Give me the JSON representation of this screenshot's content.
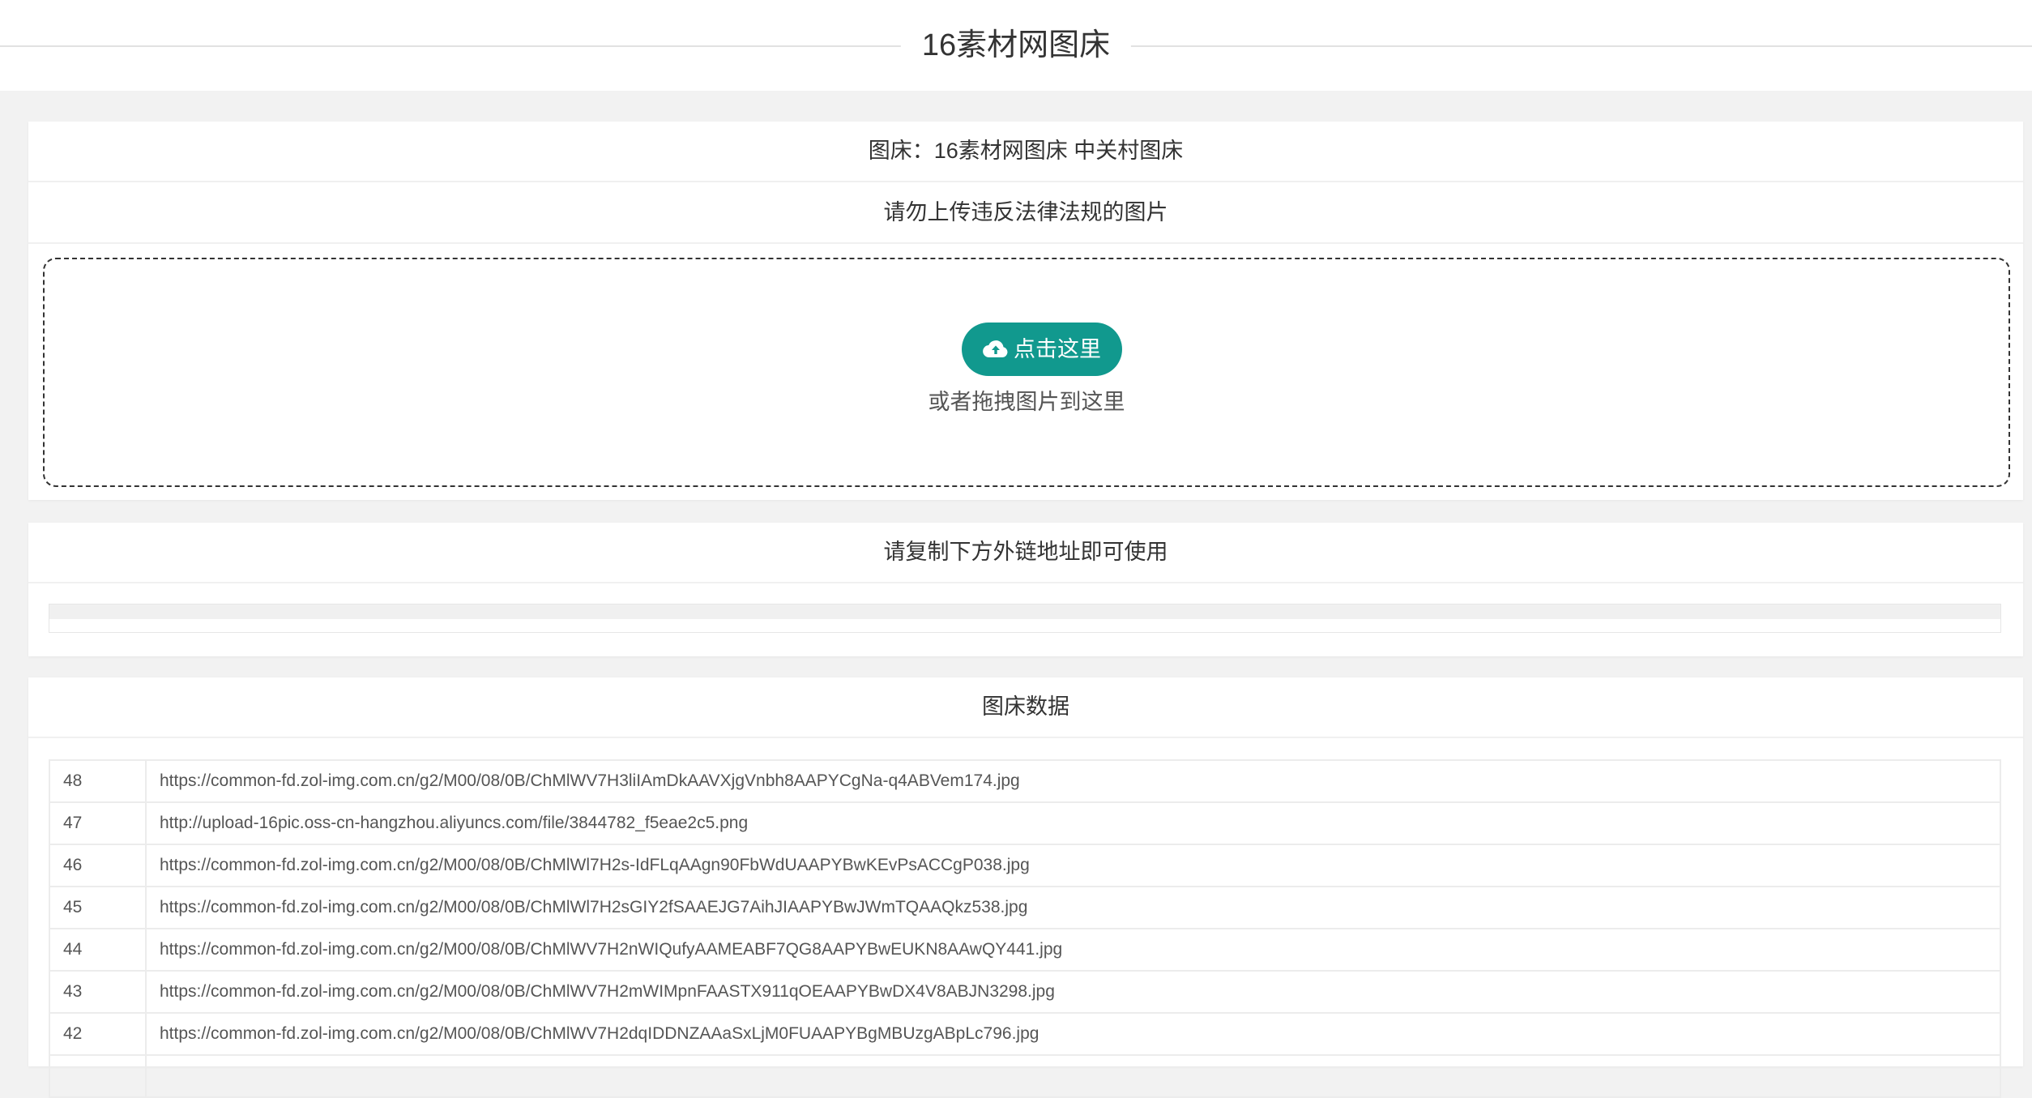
{
  "header": {
    "title": "16素材网图床"
  },
  "upload_card": {
    "bed_label": "图床：16素材网图床  中关村图床",
    "notice": "请勿上传违反法律法规的图片",
    "button_label": "点击这里",
    "drop_hint": "或者拖拽图片到这里"
  },
  "link_card": {
    "title": "请复制下方外链地址即可使用"
  },
  "data_card": {
    "title": "图床数据",
    "rows": [
      {
        "id": "48",
        "url": "https://common-fd.zol-img.com.cn/g2/M00/08/0B/ChMlWV7H3liIAmDkAAVXjgVnbh8AAPYCgNa-q4ABVem174.jpg"
      },
      {
        "id": "47",
        "url": "http://upload-16pic.oss-cn-hangzhou.aliyuncs.com/file/3844782_f5eae2c5.png"
      },
      {
        "id": "46",
        "url": "https://common-fd.zol-img.com.cn/g2/M00/08/0B/ChMlWl7H2s-IdFLqAAgn90FbWdUAAPYBwKEvPsACCgP038.jpg"
      },
      {
        "id": "45",
        "url": "https://common-fd.zol-img.com.cn/g2/M00/08/0B/ChMlWl7H2sGIY2fSAAEJG7AihJIAAPYBwJWmTQAAQkz538.jpg"
      },
      {
        "id": "44",
        "url": "https://common-fd.zol-img.com.cn/g2/M00/08/0B/ChMlWV7H2nWIQufyAAMEABF7QG8AAPYBwEUKN8AAwQY441.jpg"
      },
      {
        "id": "43",
        "url": "https://common-fd.zol-img.com.cn/g2/M00/08/0B/ChMlWV7H2mWIMpnFAASTX911qOEAAPYBwDX4V8ABJN3298.jpg"
      },
      {
        "id": "42",
        "url": "https://common-fd.zol-img.com.cn/g2/M00/08/0B/ChMlWV7H2dqIDDNZAAaSxLjM0FUAAPYBgMBUzgABpLc796.jpg"
      },
      {
        "id": "",
        "url": ""
      }
    ]
  },
  "colors": {
    "accent": "#11998e",
    "page_background": "#f2f2f2"
  },
  "icons": {
    "upload": "cloud-upload-icon"
  }
}
